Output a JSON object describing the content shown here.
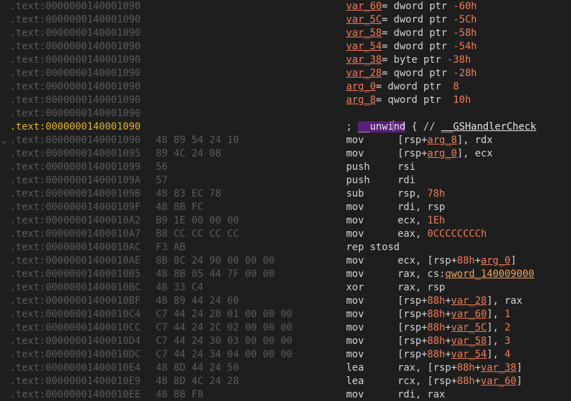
{
  "listing": {
    "lines": [
      {
        "address": ".text:0000000140001090",
        "bytes": "",
        "decl": [
          [
            "var",
            "var_60"
          ],
          [
            "pl",
            "= dword ptr "
          ],
          [
            "num",
            "-60h"
          ]
        ]
      },
      {
        "address": ".text:0000000140001090",
        "bytes": "",
        "decl": [
          [
            "var",
            "var_5C"
          ],
          [
            "pl",
            "= dword ptr "
          ],
          [
            "num",
            "-5Ch"
          ]
        ]
      },
      {
        "address": ".text:0000000140001090",
        "bytes": "",
        "decl": [
          [
            "var",
            "var_58"
          ],
          [
            "pl",
            "= dword ptr "
          ],
          [
            "num",
            "-58h"
          ]
        ]
      },
      {
        "address": ".text:0000000140001090",
        "bytes": "",
        "decl": [
          [
            "var",
            "var_54"
          ],
          [
            "pl",
            "= dword ptr "
          ],
          [
            "num",
            "-54h"
          ]
        ]
      },
      {
        "address": ".text:0000000140001090",
        "bytes": "",
        "decl": [
          [
            "var",
            "var_38"
          ],
          [
            "pl",
            "= byte ptr "
          ],
          [
            "num",
            "-38h"
          ]
        ]
      },
      {
        "address": ".text:0000000140001090",
        "bytes": "",
        "decl": [
          [
            "var",
            "var_28"
          ],
          [
            "pl",
            "= qword ptr "
          ],
          [
            "num",
            "-28h"
          ]
        ]
      },
      {
        "address": ".text:0000000140001090",
        "bytes": "",
        "decl": [
          [
            "var",
            "arg_0"
          ],
          [
            "pl",
            "= dword ptr  "
          ],
          [
            "num",
            "8"
          ]
        ]
      },
      {
        "address": ".text:0000000140001090",
        "bytes": "",
        "decl": [
          [
            "var",
            "arg_8"
          ],
          [
            "pl",
            "= qword ptr  "
          ],
          [
            "num",
            "10h"
          ]
        ]
      },
      {
        "address": ".text:0000000140001090",
        "bytes": ""
      },
      {
        "address": ".text:0000000140001090",
        "bytes": "",
        "current": true,
        "comment": true,
        "decl": [
          [
            "pl",
            "; "
          ],
          [
            "unw",
            "__unwi"
          ],
          [
            "cursor",
            ""
          ],
          [
            "unw",
            "nd"
          ],
          [
            "pl",
            " { // "
          ],
          [
            "gsh",
            "__GSHandlerCheck"
          ]
        ]
      },
      {
        "address": ".text:0000000140001090",
        "bytes": "48 89 54 24 10",
        "arrow": "⌄",
        "mnemonic": "mov",
        "ops": [
          [
            "pl",
            "["
          ],
          [
            "pl",
            "rsp+"
          ],
          [
            "var",
            "arg_8"
          ],
          [
            "pl",
            "], rdx"
          ]
        ]
      },
      {
        "address": ".text:0000000140001095",
        "bytes": "89 4C 24 08",
        "mnemonic": "mov",
        "ops": [
          [
            "pl",
            "[rsp+"
          ],
          [
            "var",
            "arg_0"
          ],
          [
            "pl",
            "], ecx"
          ]
        ]
      },
      {
        "address": ".text:0000000140001099",
        "bytes": "56",
        "mnemonic": "push",
        "ops": [
          [
            "pl",
            "rsi"
          ]
        ]
      },
      {
        "address": ".text:000000014000109A",
        "bytes": "57",
        "mnemonic": "push",
        "ops": [
          [
            "pl",
            "rdi"
          ]
        ]
      },
      {
        "address": ".text:000000014000109B",
        "bytes": "48 83 EC 78",
        "mnemonic": "sub",
        "ops": [
          [
            "pl",
            "rsp, "
          ],
          [
            "num",
            "78h"
          ]
        ]
      },
      {
        "address": ".text:000000014000109F",
        "bytes": "48 8B FC",
        "mnemonic": "mov",
        "ops": [
          [
            "pl",
            "rdi, rsp"
          ]
        ]
      },
      {
        "address": ".text:00000001400010A2",
        "bytes": "B9 1E 00 00 00",
        "mnemonic": "mov",
        "ops": [
          [
            "pl",
            "ecx, "
          ],
          [
            "num",
            "1Eh"
          ]
        ]
      },
      {
        "address": ".text:00000001400010A7",
        "bytes": "B8 CC CC CC CC",
        "mnemonic": "mov",
        "ops": [
          [
            "pl",
            "eax, "
          ],
          [
            "num",
            "0CCCCCCCCh"
          ]
        ]
      },
      {
        "address": ".text:00000001400010AC",
        "bytes": "F3 AB",
        "mnemonic": "rep stosd",
        "ops": []
      },
      {
        "address": ".text:00000001400010AE",
        "bytes": "8B 8C 24 90 00 00 00",
        "mnemonic": "mov",
        "ops": [
          [
            "pl",
            "ecx, [rsp+"
          ],
          [
            "num",
            "88h"
          ],
          [
            "pl",
            "+"
          ],
          [
            "var",
            "arg_0"
          ],
          [
            "pl",
            "]"
          ]
        ]
      },
      {
        "address": ".text:00000001400010B5",
        "bytes": "48 8B 05 44 7F 00 00",
        "mnemonic": "mov",
        "ops": [
          [
            "pl",
            "rax, cs:"
          ],
          [
            "sym",
            "qword_140009000"
          ]
        ]
      },
      {
        "address": ".text:00000001400010BC",
        "bytes": "48 33 C4",
        "mnemonic": "xor",
        "ops": [
          [
            "pl",
            "rax, rsp"
          ]
        ]
      },
      {
        "address": ".text:00000001400010BF",
        "bytes": "48 89 44 24 60",
        "mnemonic": "mov",
        "ops": [
          [
            "pl",
            "[rsp+"
          ],
          [
            "num",
            "88h"
          ],
          [
            "pl",
            "+"
          ],
          [
            "var",
            "var_28"
          ],
          [
            "pl",
            "], rax"
          ]
        ]
      },
      {
        "address": ".text:00000001400010C4",
        "bytes": "C7 44 24 28 01 00 00 00",
        "mnemonic": "mov",
        "ops": [
          [
            "pl",
            "[rsp+"
          ],
          [
            "num",
            "88h"
          ],
          [
            "pl",
            "+"
          ],
          [
            "var",
            "var_60"
          ],
          [
            "pl",
            "], "
          ],
          [
            "num",
            "1"
          ]
        ]
      },
      {
        "address": ".text:00000001400010CC",
        "bytes": "C7 44 24 2C 02 00 00 00",
        "mnemonic": "mov",
        "ops": [
          [
            "pl",
            "[rsp+"
          ],
          [
            "num",
            "88h"
          ],
          [
            "pl",
            "+"
          ],
          [
            "var",
            "var_5C"
          ],
          [
            "pl",
            "], "
          ],
          [
            "num",
            "2"
          ]
        ]
      },
      {
        "address": ".text:00000001400010D4",
        "bytes": "C7 44 24 30 03 00 00 00",
        "mnemonic": "mov",
        "ops": [
          [
            "pl",
            "[rsp+"
          ],
          [
            "num",
            "88h"
          ],
          [
            "pl",
            "+"
          ],
          [
            "var",
            "var_58"
          ],
          [
            "pl",
            "], "
          ],
          [
            "num",
            "3"
          ]
        ]
      },
      {
        "address": ".text:00000001400010DC",
        "bytes": "C7 44 24 34 04 00 00 00",
        "mnemonic": "mov",
        "ops": [
          [
            "pl",
            "[rsp+"
          ],
          [
            "num",
            "88h"
          ],
          [
            "pl",
            "+"
          ],
          [
            "var",
            "var_54"
          ],
          [
            "pl",
            "], "
          ],
          [
            "num",
            "4"
          ]
        ]
      },
      {
        "address": ".text:00000001400010E4",
        "bytes": "48 8D 44 24 50",
        "mnemonic": "lea",
        "ops": [
          [
            "pl",
            "rax, [rsp+"
          ],
          [
            "num",
            "88h"
          ],
          [
            "pl",
            "+"
          ],
          [
            "var",
            "var_38"
          ],
          [
            "pl",
            "]"
          ]
        ]
      },
      {
        "address": ".text:00000001400010E9",
        "bytes": "48 8D 4C 24 28",
        "mnemonic": "lea",
        "ops": [
          [
            "pl",
            "rcx, [rsp+"
          ],
          [
            "num",
            "88h"
          ],
          [
            "pl",
            "+"
          ],
          [
            "var",
            "var_60"
          ],
          [
            "pl",
            "]"
          ]
        ]
      },
      {
        "address": ".text:00000001400010EE",
        "bytes": "48 8B F8",
        "mnemonic": "mov",
        "ops": [
          [
            "pl",
            "rdi, rax"
          ]
        ]
      }
    ]
  },
  "colors": {
    "background": "#1e1e1e",
    "address": "#5b5b5b",
    "current_address": "#e6b422",
    "variable": "#f07d5a",
    "highlight": "#5b1f78"
  }
}
